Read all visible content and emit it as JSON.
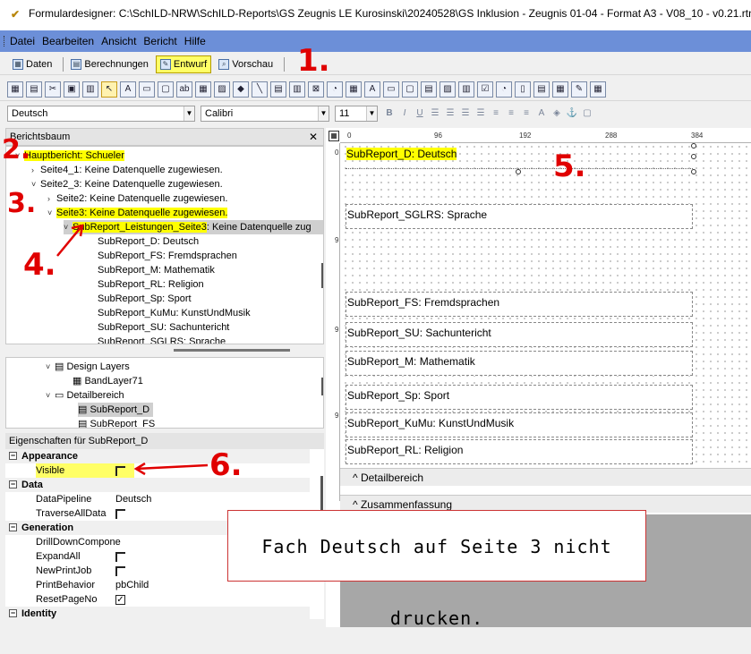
{
  "window": {
    "title": "Formulardesigner: C:\\SchILD-NRW\\SchILD-Reports\\GS Zeugnis LE Kurosinski\\20240528\\GS Inklusion - Zeugnis 01-04 - Format A3 - V08_10 - v0.21.rtm"
  },
  "menu": [
    "Datei",
    "Bearbeiten",
    "Ansicht",
    "Bericht",
    "Hilfe"
  ],
  "tabs": {
    "daten": "Daten",
    "berechnungen": "Berechnungen",
    "entwurf": "Entwurf",
    "vorschau": "Vorschau"
  },
  "fontbar": {
    "font_name": "Deutsch",
    "font_family": "Calibri",
    "font_size": "11"
  },
  "tree_panel": {
    "title": "Berichtsbaum",
    "items": [
      "Hauptbericht: Schueler",
      "Seite4_1: Keine Datenquelle zugewiesen.",
      "Seite2_3: Keine Datenquelle zugewiesen.",
      "Seite2: Keine Datenquelle zugewiesen.",
      "Seite3: Keine Datenquelle zugewiesen.",
      "SubReport_Leistungen_Seite3",
      ": Keine Datenquelle zug",
      "SubReport_D: Deutsch",
      "SubReport_FS: Fremdsprachen",
      "SubReport_M: Mathematik",
      "SubReport_RL: Religion",
      "SubReport_Sp: Sport",
      "SubReport_KuMu: KunstUndMusik",
      "SubReport_SU: Sachuntericht",
      "SubReport_SGLRS: Sprache"
    ]
  },
  "layer_tree": {
    "items": [
      "Design Layers",
      "BandLayer71",
      "Detailbereich",
      "SubReport_D",
      "SubReport_FS"
    ]
  },
  "properties": {
    "title": "Eigenschaften für SubReport_D",
    "appearance": "Appearance",
    "visible": "Visible",
    "data": "Data",
    "datapipeline": "DataPipeline",
    "datapipeline_value": "Deutsch",
    "traverse": "TraverseAllData",
    "generation": "Generation",
    "drilldown": "DrillDownCompone",
    "expandall": "ExpandAll",
    "newprintjob": "NewPrintJob",
    "printbehavior": "PrintBehavior",
    "printbehavior_value": "pbChild",
    "resetpageno": "ResetPageNo",
    "identity": "Identity"
  },
  "ruler": [
    "0",
    "96",
    "192",
    "288",
    "384"
  ],
  "ruler_v": [
    "0",
    "9",
    "9",
    "9"
  ],
  "designer": {
    "sr_d": "SubReport_D: Deutsch",
    "sr_sglrs": "SubReport_SGLRS: Sprache",
    "sr_fs": "SubReport_FS: Fremdsprachen",
    "sr_su": "SubReport_SU: Sachuntericht",
    "sr_m": "SubReport_M: Mathematik",
    "sr_sp": "SubReport_Sp: Sport",
    "sr_kumu": "SubReport_KuMu: KunstUndMusik",
    "sr_rl": "SubReport_RL: Religion",
    "band_detail": "Detailbereich",
    "band_summary": "Zusammenfassung"
  },
  "callout": "Fach Deutsch auf Seite 3 nicht drucken.",
  "annotations": [
    "1.",
    "2.",
    "3.",
    "4.",
    "5.",
    "6."
  ],
  "colors": {
    "menubar": "#6c8fd8",
    "highlight": "#ffff00",
    "annotation": "#e00000"
  }
}
